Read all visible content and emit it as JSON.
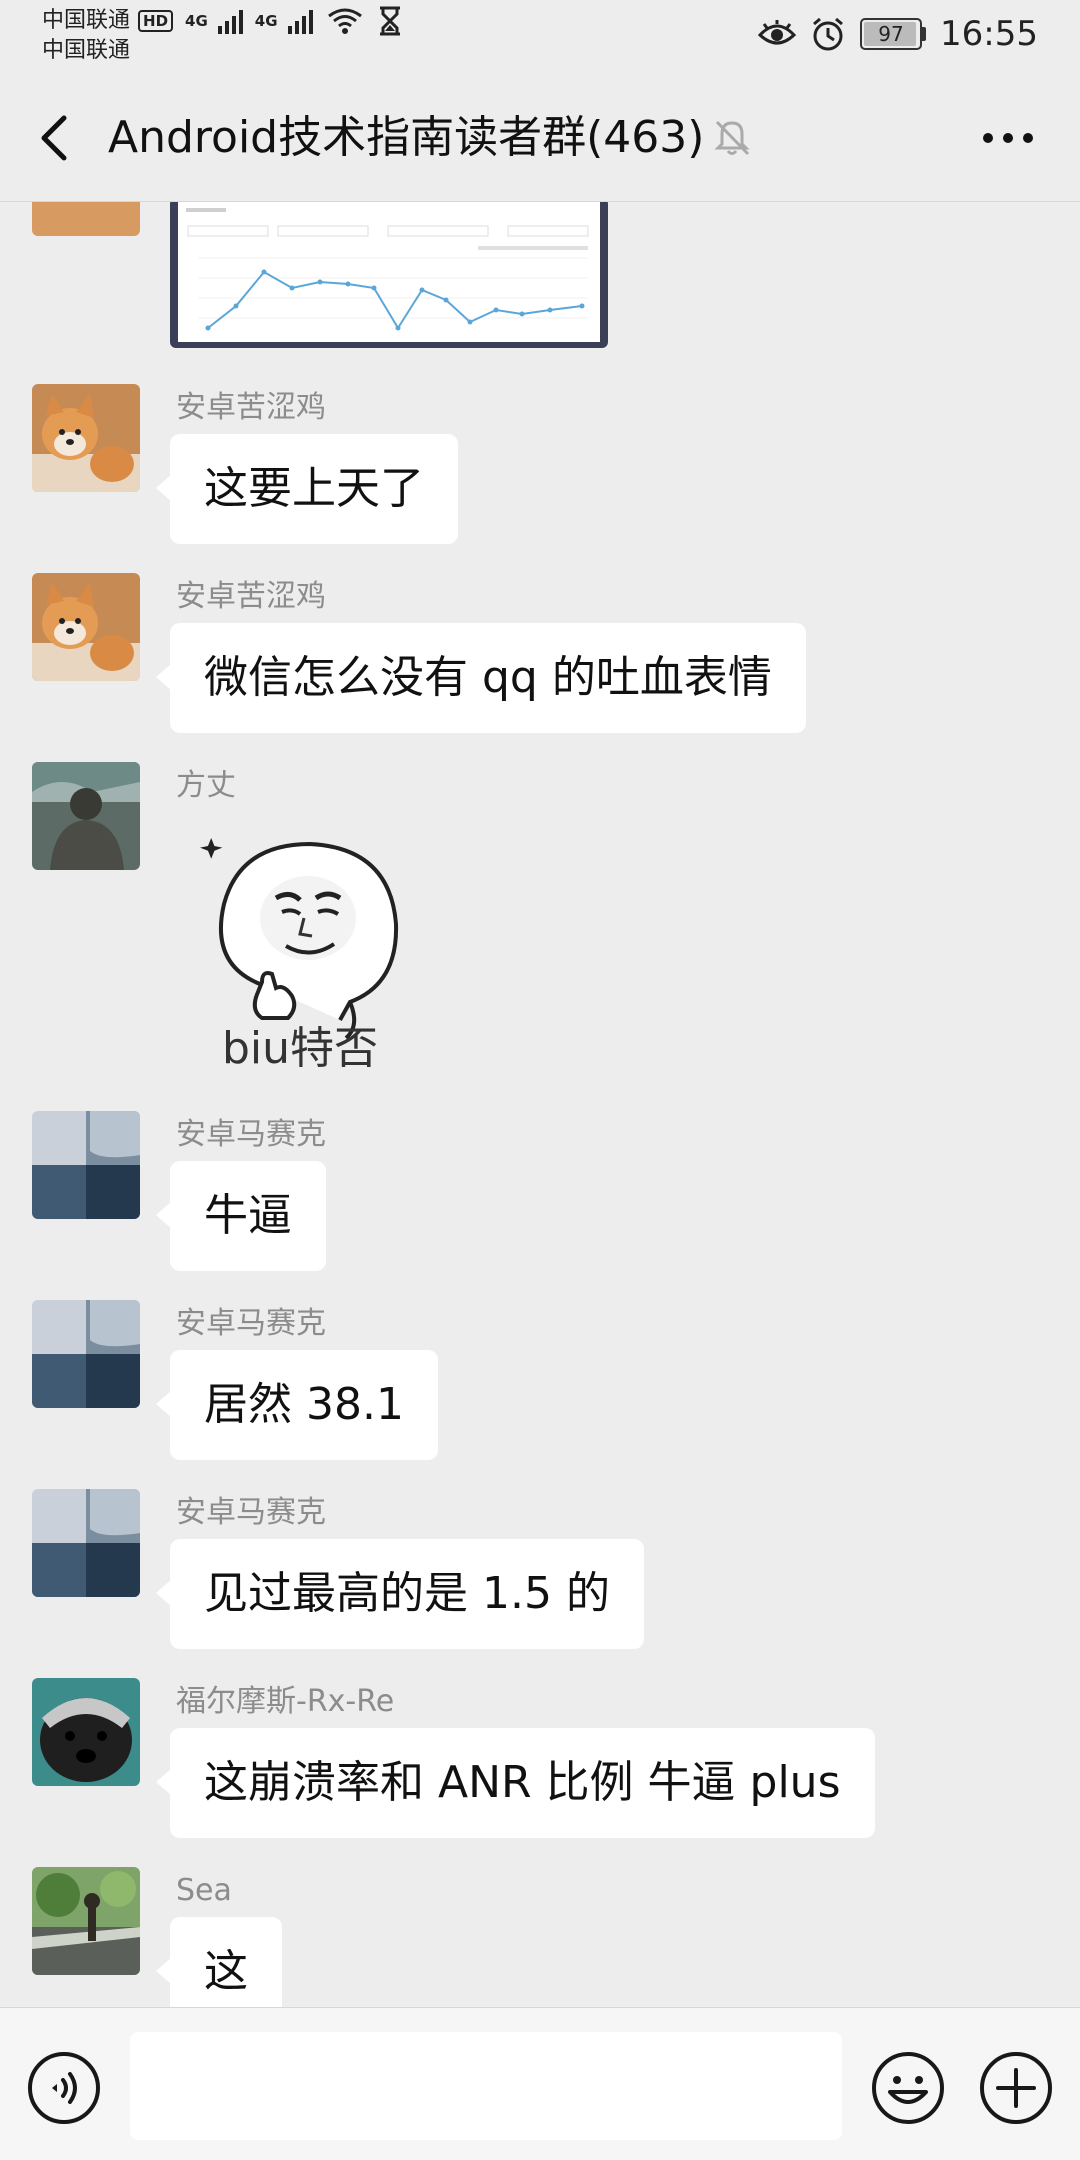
{
  "status_bar": {
    "carrier_1": "中国联通",
    "hd_badge": "HD",
    "network_1": "4G",
    "network_2": "4G",
    "carrier_2": "中国联通",
    "battery": "97",
    "battery_level": 0.97,
    "time": "16:55",
    "icons": [
      "signal-icon",
      "wifi-icon",
      "hourglass-icon",
      "eye-icon",
      "alarm-icon",
      "battery-icon"
    ]
  },
  "header": {
    "title": "Android技术指南读者群(463)",
    "icons": [
      "back-arrow-icon",
      "mute-bell-icon",
      "more-dots-icon"
    ]
  },
  "messages": [
    {
      "type": "image",
      "content": "chart-screenshot"
    },
    {
      "sender": "安卓苦涩鸡",
      "text": "这要上天了",
      "avatar": "shiba-dog"
    },
    {
      "sender": "安卓苦涩鸡",
      "text": "微信怎么没有 qq 的吐血表情",
      "avatar": "shiba-dog"
    },
    {
      "sender": "方丈",
      "sticker_caption": "biu特否",
      "avatar": "person-photo"
    },
    {
      "sender": "安卓马赛克",
      "text": "牛逼",
      "avatar": "ocean-split"
    },
    {
      "sender": "安卓马赛克",
      "text": "居然 38.1",
      "avatar": "ocean-split"
    },
    {
      "sender": "安卓马赛克",
      "text": "见过最高的是 1.5 的",
      "avatar": "ocean-split"
    },
    {
      "sender": "福尔摩斯-Rx-Re",
      "text": "这崩溃率和 ANR 比例 牛逼 plus",
      "avatar": "honey-badger"
    },
    {
      "sender": "Sea",
      "text": "这",
      "avatar": "roadside-photo"
    }
  ],
  "input_bar": {
    "placeholder": "",
    "icons": [
      "voice-icon",
      "emoji-icon",
      "plus-icon"
    ]
  },
  "colors": {
    "background": "#ededed",
    "bubble": "#ffffff",
    "sender_name": "#8c8c8c",
    "input_bar": "#f6f6f6"
  }
}
